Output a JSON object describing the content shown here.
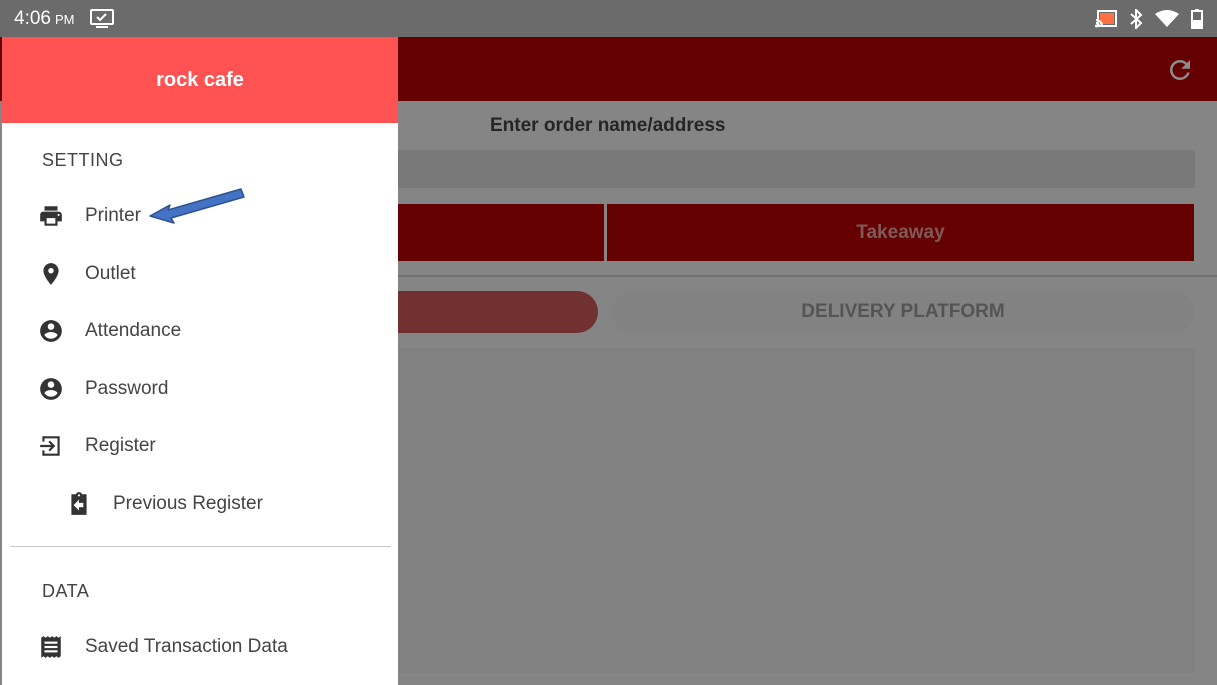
{
  "status_bar": {
    "time": "4:06",
    "ampm": "PM"
  },
  "app": {
    "order_label": "Enter order name/address",
    "takeaway_label": "Takeaway",
    "delivery_platform_label": "DELIVERY PLATFORM"
  },
  "drawer": {
    "title": "rock cafe",
    "sections": {
      "setting_label": "SETTING",
      "data_label": "DATA"
    },
    "items": {
      "printer": "Printer",
      "outlet": "Outlet",
      "attendance": "Attendance",
      "password": "Password",
      "register": "Register",
      "previous_register": "Previous Register",
      "saved_transaction_data": "Saved Transaction Data"
    }
  },
  "icons": {
    "status": [
      "monitor-check-icon",
      "cast-icon",
      "bluetooth-icon",
      "wifi-icon",
      "battery-icon"
    ],
    "menu": [
      "printer-icon",
      "location-pin-icon",
      "account-circle-icon",
      "account-circle-icon",
      "login-icon",
      "clipboard-back-icon",
      "receipt-icon"
    ],
    "toolbar": [
      "refresh-icon"
    ],
    "annotation": [
      "blue-arrow-icon"
    ]
  },
  "colors": {
    "toolbar": "#b80000",
    "drawer_header": "#ff5252",
    "status_bar": "#6b6b6b",
    "annotation_arrow": "#4472c4"
  }
}
